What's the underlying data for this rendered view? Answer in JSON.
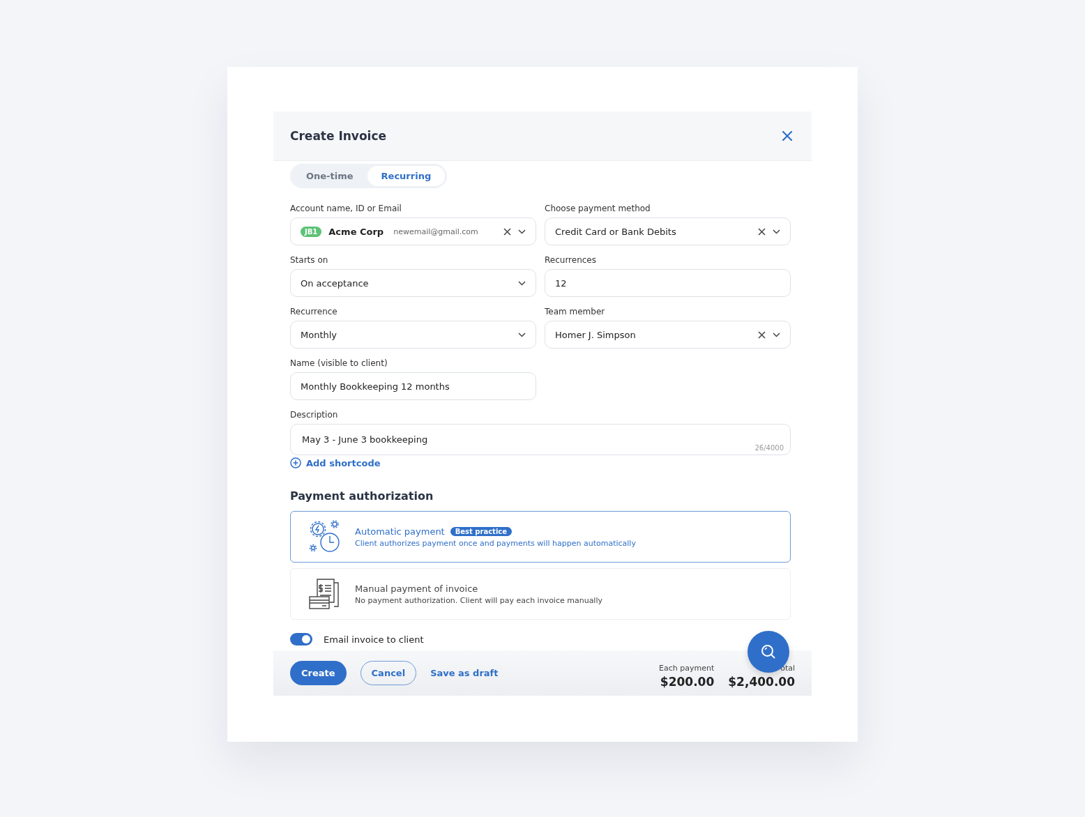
{
  "dialog": {
    "title": "Create Invoice"
  },
  "tabs": [
    {
      "label": "One-time",
      "selected": false
    },
    {
      "label": "Recurring",
      "selected": true
    }
  ],
  "fields": [
    {
      "kind": "account",
      "label": "Account name, ID or Email",
      "tag": "JB1",
      "value": "Acme Corp",
      "email": "newemail@gmail.com",
      "clearable": true,
      "dropdown": true
    },
    {
      "kind": "select",
      "label": "Choose payment method",
      "value": "Credit Card or Bank Debits",
      "clearable": true,
      "dropdown": true
    },
    {
      "kind": "select",
      "label": "Starts on",
      "value": "On acceptance",
      "clearable": false,
      "dropdown": true
    },
    {
      "kind": "input",
      "label": "Recurrences",
      "value": "12"
    },
    {
      "kind": "select",
      "label": "Recurrence",
      "value": "Monthly",
      "clearable": false,
      "dropdown": true
    },
    {
      "kind": "select",
      "label": "Team member",
      "value": "Homer J. Simpson",
      "clearable": true,
      "dropdown": true
    },
    {
      "kind": "input",
      "label": "Name (visible to client)",
      "value": "Monthly Bookkeeping  12 months"
    },
    {
      "kind": "textarea",
      "label": "Description",
      "value": "May 3 - June 3 bookkeeping",
      "counter": "26/4000"
    }
  ],
  "add_shortcode": "Add shortcode",
  "payment_authorization": {
    "heading": "Payment authorization",
    "options": [
      {
        "kind": "automatic",
        "title": "Automatic payment",
        "badge": "Best practice",
        "description": "Client authorizes payment once and payments will happen automatically",
        "selected": true
      },
      {
        "kind": "manual",
        "title": "Manual payment of invoice",
        "description": "No payment authorization. Client will pay each invoice manually",
        "selected": false
      }
    ]
  },
  "email_toggle": {
    "label": "Email invoice to client",
    "on": true
  },
  "footer": {
    "buttons": [
      {
        "kind": "primary",
        "label": "Create"
      },
      {
        "kind": "outline",
        "label": "Cancel"
      },
      {
        "kind": "link",
        "label": "Save as draft"
      }
    ],
    "totals": [
      {
        "label": "Each payment",
        "value": "$200.00"
      },
      {
        "label": "otal",
        "value": "$2,400.00"
      }
    ]
  }
}
